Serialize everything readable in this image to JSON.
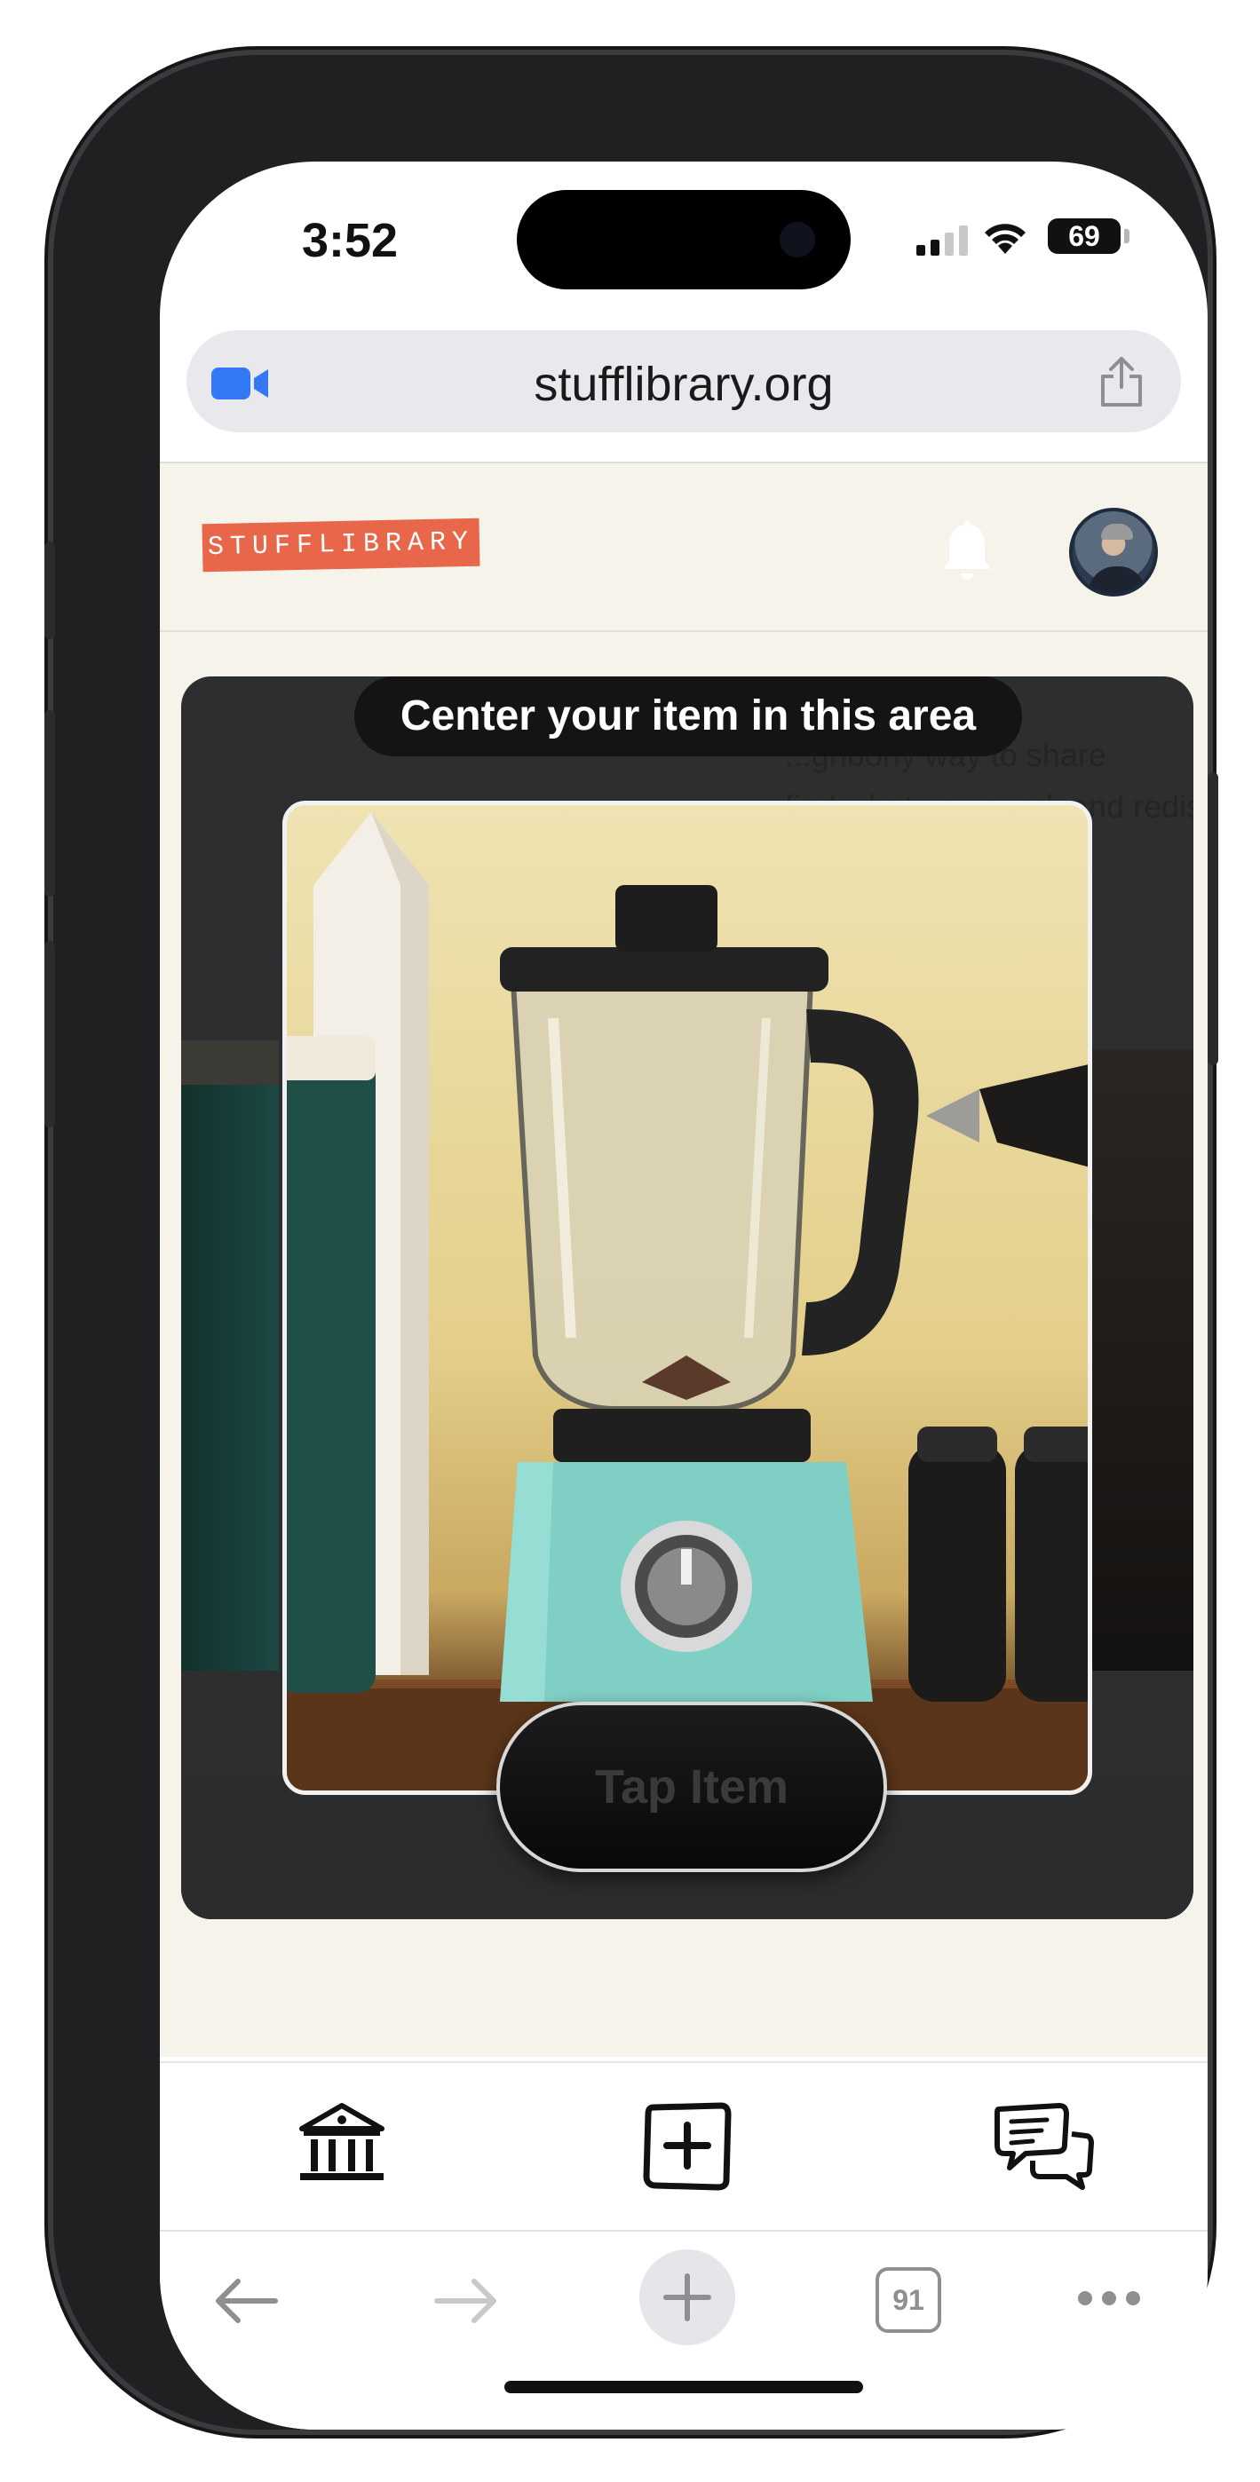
{
  "status_bar": {
    "time": "3:52",
    "battery": "69"
  },
  "browser": {
    "url": "stufflibrary.org",
    "tab_count": "91"
  },
  "site": {
    "logo": "STUFFLIBRARY"
  },
  "scanner": {
    "hint": "Center your item in this area",
    "tap_button": "Tap Item",
    "background_text_line1": "...ghborly way to share",
    "background_text_line2": "find what you need, and redis..."
  },
  "app_nav": {
    "items": [
      {
        "icon": "library-icon"
      },
      {
        "icon": "add-item-icon"
      },
      {
        "icon": "messages-icon"
      }
    ]
  },
  "toolbar": {
    "items": [
      {
        "icon": "back-arrow-icon"
      },
      {
        "icon": "forward-arrow-icon"
      },
      {
        "icon": "new-tab-icon"
      },
      {
        "icon": "tabs-icon"
      },
      {
        "icon": "more-icon"
      }
    ]
  },
  "colors": {
    "logo_bg": "#e8674a",
    "page_bg": "#f6f3eb",
    "scanner_bg": "#2d2e30",
    "accent_blue": "#3478f6"
  }
}
